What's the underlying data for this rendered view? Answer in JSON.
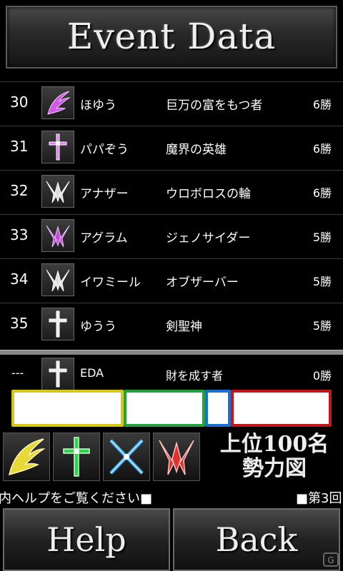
{
  "header": {
    "title": "Event Data"
  },
  "rows": [
    {
      "rank": "30",
      "icon": "wing-icon",
      "name": "ほゆう",
      "title": "巨万の富をもつ者",
      "wins": "6勝"
    },
    {
      "rank": "31",
      "icon": "cross-icon",
      "name": "パパぞう",
      "title": "魔界の英雄",
      "wins": "6勝"
    },
    {
      "rank": "32",
      "icon": "claw-icon",
      "name": "アナザー",
      "title": "ウロボロスの輪",
      "wins": "6勝"
    },
    {
      "rank": "33",
      "icon": "claw-icon",
      "name": "アグラム",
      "title": "ジェノサイダー",
      "wins": "5勝"
    },
    {
      "rank": "34",
      "icon": "claw-icon",
      "name": "イワミール",
      "title": "オブザーバー",
      "wins": "5勝"
    },
    {
      "rank": "35",
      "icon": "cross-icon",
      "name": "ゆうう",
      "title": "剣聖神",
      "wins": "5勝"
    }
  ],
  "self_row": {
    "rank": "---",
    "icon": "cross-icon",
    "name": "EDA",
    "title": "財を成す者",
    "wins": "0勝"
  },
  "power_bar": {
    "segments": [
      {
        "faction": "wing",
        "color": "#d4c61a",
        "share": 0.35
      },
      {
        "faction": "cross",
        "color": "#1fa33a",
        "share": 0.255
      },
      {
        "faction": "sword",
        "color": "#1a6fd1",
        "share": 0.08
      },
      {
        "faction": "claw",
        "color": "#c01818",
        "share": 0.315
      }
    ]
  },
  "faction_icons": [
    "wing-icon",
    "cross-icon",
    "crossed-swords-icon",
    "claw-icon"
  ],
  "legend": {
    "line1": "上位100名",
    "line2": "勢力図"
  },
  "ticker": {
    "left": "内ヘルプをご覧ください■",
    "right": "■第3回"
  },
  "buttons": {
    "help": "Help",
    "back": "Back"
  },
  "watermark": "G"
}
